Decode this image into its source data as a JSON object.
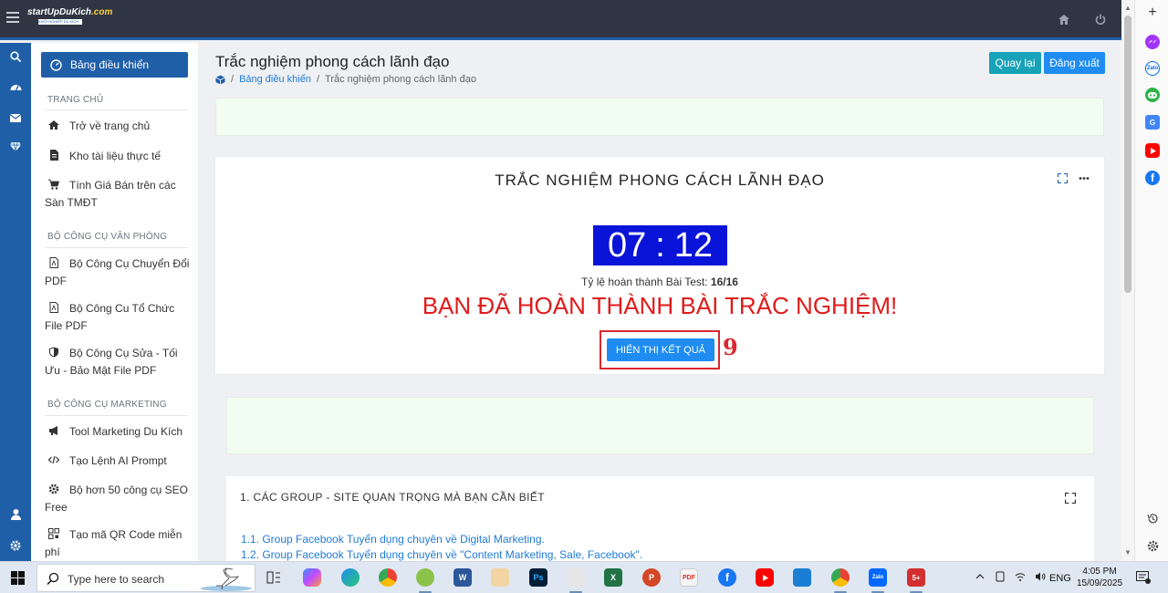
{
  "header": {
    "logo_text_main": "startUpDuKich",
    "logo_text_suffix": ".com",
    "logo_tagline": "KHỞI NGHIỆP DU KÍCH"
  },
  "sidebar": {
    "active_item": "Bảng điều khiển",
    "sections": [
      {
        "title": "TRANG CHỦ",
        "items": [
          "Trở về trang chủ",
          "Kho tài liệu thực tế",
          "Tính Giá Bán trên các Sàn TMĐT"
        ]
      },
      {
        "title": "BỘ CÔNG CỤ VĂN PHÒNG",
        "items": [
          "Bộ Công Cụ Chuyển Đổi PDF",
          "Bộ Công Cu Tổ Chức File PDF",
          "Bộ Công Cụ Sửa - Tối Ưu - Bảo Mật File PDF"
        ]
      },
      {
        "title": "BỘ CÔNG CỤ MARKETING",
        "items": [
          "Tool Marketing Du Kích",
          "Tạo Lệnh AI Prompt",
          "Bộ hơn 50 công cụ SEO Free",
          "Tạo mã QR Code miễn phí"
        ]
      }
    ]
  },
  "page": {
    "title": "Trắc nghiệm phong cách lãnh đạo",
    "breadcrumb": {
      "home": "Bảng điều khiển",
      "separator": "/",
      "current": "Trắc nghiệm phong cách lãnh đạo"
    },
    "back_button": "Quay lại",
    "logout_button": "Đăng xuất"
  },
  "quiz": {
    "title": "TRẮC NGHIỆM PHONG CÁCH LÃNH ĐẠO",
    "timer_minutes": "07",
    "timer_separator": ":",
    "timer_seconds": "12",
    "progress_label": "Tỷ lệ hoàn thành Bài Test:",
    "progress_value": "16/16",
    "completed_message": "BẠN ĐÃ HOÀN THÀNH BÀI TRẮC NGHIỆM!",
    "show_result_button": "HIỂN THỊ KẾT QUẢ",
    "annotation_number": "9"
  },
  "groups_card": {
    "title": "1. CÁC GROUP - SITE QUAN TRỌNG MÀ BẠN CẦN BIẾT",
    "links": [
      "1.1. Group Facebook Tuyển dụng chuyên về Digital Marketing.",
      "1.2. Group Facebook Tuyển dụng chuyên về \"Content Marketing, Sale, Facebook\"."
    ]
  },
  "taskbar": {
    "search_placeholder": "Type here to search",
    "language": "ENG",
    "time": "4:05 PM",
    "date": "15/09/2025"
  },
  "colors": {
    "primary": "#1f5fa8",
    "timer_bg": "#0a13d8",
    "alert_red": "#e01b1b",
    "annotation_red": "#d9272e",
    "info_teal": "#17a2b8"
  }
}
